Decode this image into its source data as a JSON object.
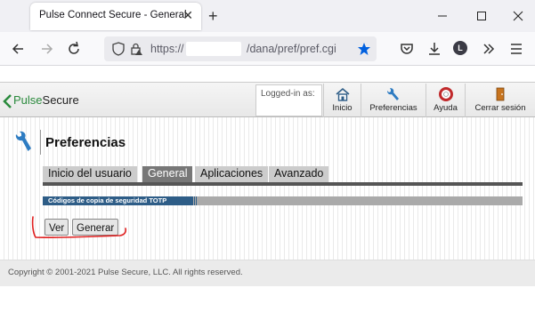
{
  "browser": {
    "tab_title": "Pulse Connect Secure - General",
    "tab_close_glyph": "✕",
    "new_tab_glyph": "+",
    "url_protocol": "https://",
    "url_path": "/dana/pref/pref.cgi",
    "profile_initial": "L"
  },
  "header": {
    "logo_primary": "Pulse",
    "logo_secondary": "Secure",
    "logged_in_label": "Logged-in as:",
    "toolbar": [
      {
        "label": "Inicio",
        "icon": "home-icon"
      },
      {
        "label": "Preferencias",
        "icon": "wrench-icon"
      },
      {
        "label": "Ayuda",
        "icon": "lifebuoy-icon"
      },
      {
        "label": "Cerrar sesión",
        "icon": "door-exit-icon"
      }
    ]
  },
  "main": {
    "title": "Preferencias",
    "tabs": [
      {
        "label": "Inicio del usuario",
        "active": false
      },
      {
        "label": "General",
        "active": true
      },
      {
        "label": "Aplicaciones",
        "active": false
      },
      {
        "label": "Avanzado",
        "active": false
      }
    ],
    "section_title": "Códigos de copia de seguridad TOTP",
    "buttons": {
      "view": "Ver",
      "generate": "Generar"
    }
  },
  "footer": {
    "copyright": "Copyright © 2001-2021 Pulse Secure, LLC. All rights reserved."
  },
  "colors": {
    "active_tab": "#777777",
    "section_header": "#2e5d87",
    "logo_accent": "#2a8a3c",
    "annotation": "#e02020"
  }
}
